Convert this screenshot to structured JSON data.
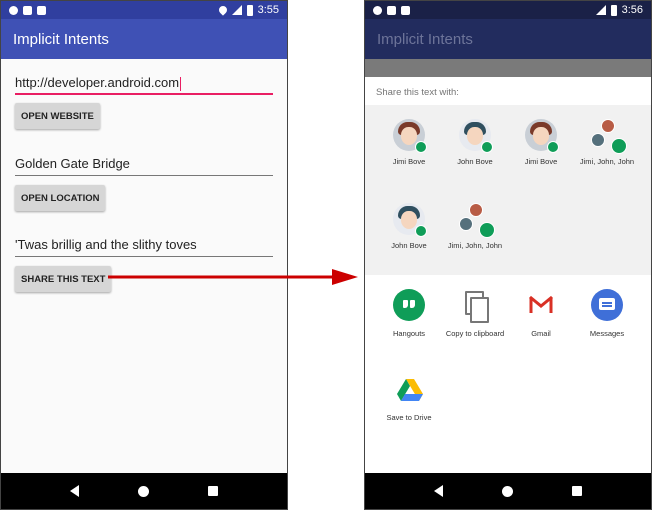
{
  "status_left": {
    "time": "3:55",
    "network": "LTE"
  },
  "status_right": {
    "time": "3:56",
    "network": "LTE"
  },
  "app_title": "Implicit Intents",
  "left_screen": {
    "website_input_value": "http://developer.android.com",
    "open_website_label": "OPEN WEBSITE",
    "location_input_value": "Golden Gate Bridge",
    "open_location_label": "OPEN LOCATION",
    "share_input_value": "'Twas brillig and the slithy toves",
    "share_text_label": "SHARE THIS TEXT"
  },
  "share_sheet": {
    "title": "Share this text with:",
    "direct_targets": [
      {
        "label": "Jimi Bove",
        "icon": "contact-avatar-icon"
      },
      {
        "label": "John Bove",
        "icon": "contact-avatar-icon"
      },
      {
        "label": "Jimi Bove",
        "icon": "contact-avatar-icon"
      },
      {
        "label": "Jimi, John, John",
        "icon": "group-avatar-icon"
      },
      {
        "label": "John Bove",
        "icon": "contact-avatar-icon"
      },
      {
        "label": "Jimi, John, John",
        "icon": "group-avatar-icon"
      }
    ],
    "apps": [
      {
        "label": "Hangouts",
        "icon": "hangouts-icon"
      },
      {
        "label": "Copy to clipboard",
        "icon": "copy-icon"
      },
      {
        "label": "Gmail",
        "icon": "gmail-icon"
      },
      {
        "label": "Messages",
        "icon": "messages-icon"
      },
      {
        "label": "Save to Drive",
        "icon": "drive-icon"
      }
    ]
  },
  "colors": {
    "primary": "#3f51b5",
    "primary_dark": "#303f9f",
    "accent": "#e91e63",
    "arrow": "#cc0000"
  }
}
